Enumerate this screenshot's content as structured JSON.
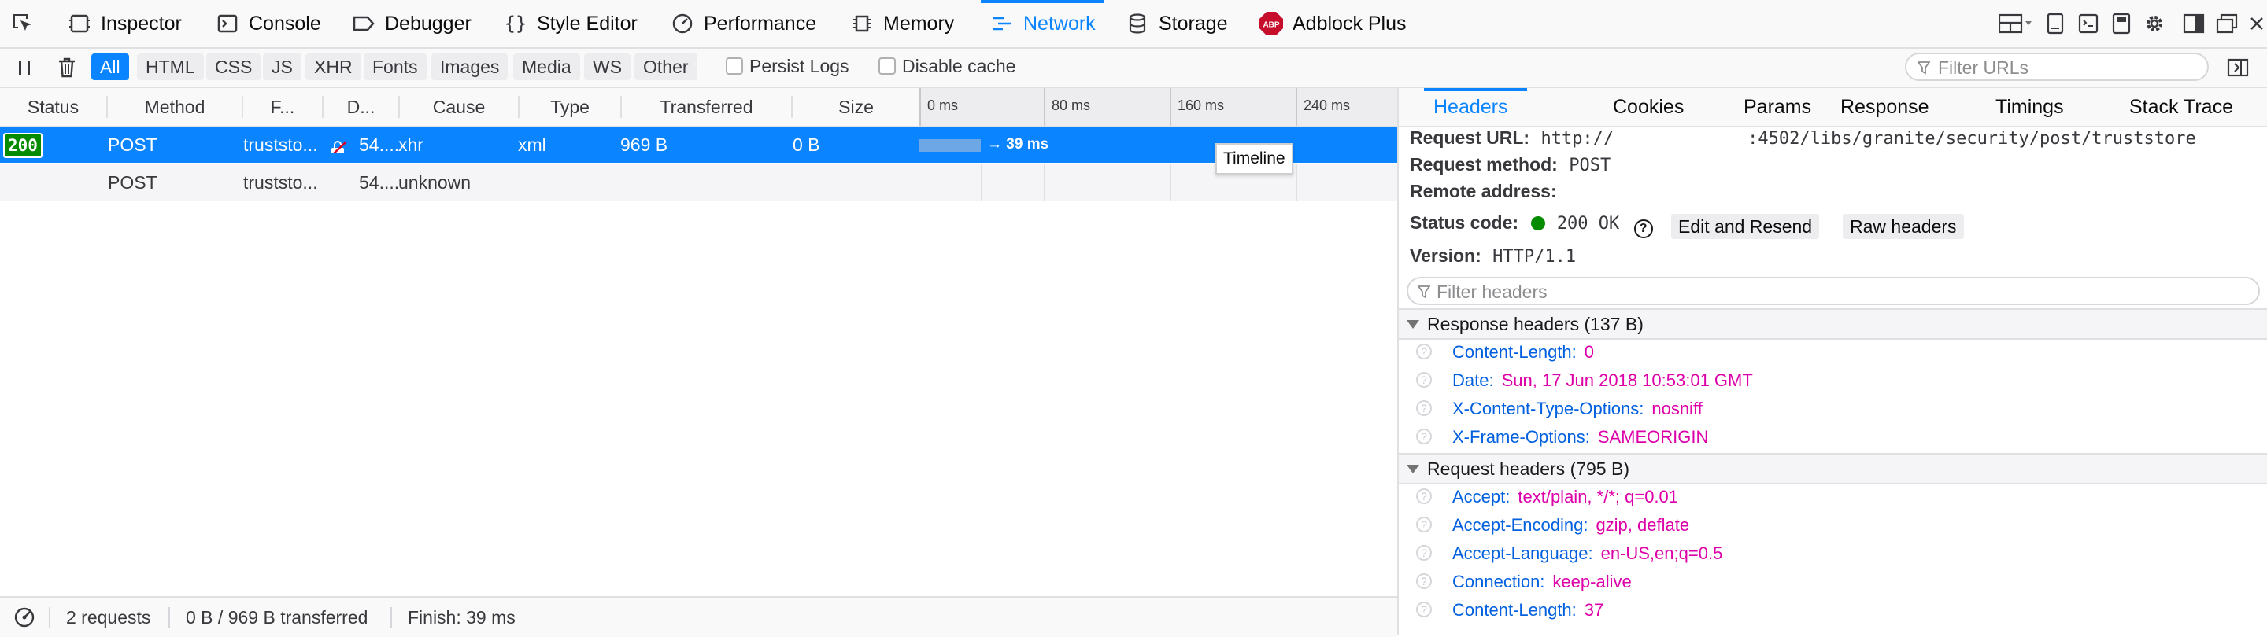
{
  "toolbar": {
    "tabs": [
      {
        "label": "Inspector",
        "icon": "inspector-icon"
      },
      {
        "label": "Console",
        "icon": "console-icon"
      },
      {
        "label": "Debugger",
        "icon": "debugger-icon"
      },
      {
        "label": "Style Editor",
        "icon": "style-editor-icon"
      },
      {
        "label": "Performance",
        "icon": "performance-icon"
      },
      {
        "label": "Memory",
        "icon": "memory-icon"
      },
      {
        "label": "Network",
        "icon": "network-icon",
        "active": true
      },
      {
        "label": "Storage",
        "icon": "storage-icon"
      },
      {
        "label": "Adblock Plus",
        "icon": "adblock-plus-icon"
      }
    ],
    "abp_badge": "ABP",
    "accent_color": "#0a84ff"
  },
  "filterbar": {
    "types": [
      "All",
      "HTML",
      "CSS",
      "JS",
      "XHR",
      "Fonts",
      "Images",
      "Media",
      "WS",
      "Other"
    ],
    "active_type": "All",
    "persist_logs_label": "Persist Logs",
    "disable_cache_label": "Disable cache",
    "filter_urls_placeholder": "Filter URLs"
  },
  "table": {
    "columns": [
      "Status",
      "Method",
      "F...",
      "D...",
      "Cause",
      "Type",
      "Transferred",
      "Size"
    ],
    "waterfall_ticks": [
      "0 ms",
      "80 ms",
      "160 ms",
      "240 ms"
    ],
    "rows": [
      {
        "status": "200",
        "method": "POST",
        "file": "truststo...",
        "domain": "54....",
        "cause": "xhr",
        "type": "xml",
        "transferred": "969 B",
        "size": "0 B",
        "timing": "→ 39 ms",
        "selected": true
      },
      {
        "status": "",
        "method": "POST",
        "file": "truststo...",
        "domain": "54....",
        "cause": "unknown",
        "type": "",
        "transferred": "",
        "size": "",
        "timing": "",
        "selected": false
      }
    ],
    "tooltip": "Timeline"
  },
  "statusbar": {
    "requests": "2 requests",
    "transferred": "0 B / 969 B transferred",
    "finish": "Finish: 39 ms"
  },
  "details": {
    "tabs": [
      "Headers",
      "Cookies",
      "Params",
      "Response",
      "Timings",
      "Stack Trace"
    ],
    "active_tab": "Headers",
    "request_url_label": "Request URL:",
    "request_url_value": "http://",
    "request_url_value_tail": ":4502/libs/granite/security/post/truststore",
    "request_method_label": "Request method:",
    "request_method_value": "POST",
    "remote_address_label": "Remote address:",
    "status_code_label": "Status code:",
    "status_code_value": "200 OK",
    "status_color": "#058b00",
    "edit_resend_label": "Edit and Resend",
    "raw_headers_label": "Raw headers",
    "version_label": "Version:",
    "version_value": "HTTP/1.1",
    "filter_headers_placeholder": "Filter headers",
    "response_headers_title": "Response headers (137 B)",
    "response_headers": [
      {
        "name": "Content-Length:",
        "value": "0"
      },
      {
        "name": "Date:",
        "value": "Sun, 17 Jun 2018 10:53:01 GMT"
      },
      {
        "name": "X-Content-Type-Options:",
        "value": "nosniff"
      },
      {
        "name": "X-Frame-Options:",
        "value": "SAMEORIGIN"
      }
    ],
    "request_headers_title": "Request headers (795 B)",
    "request_headers": [
      {
        "name": "Accept:",
        "value": "text/plain, */*; q=0.01"
      },
      {
        "name": "Accept-Encoding:",
        "value": "gzip, deflate"
      },
      {
        "name": "Accept-Language:",
        "value": "en-US,en;q=0.5"
      },
      {
        "name": "Connection:",
        "value": "keep-alive"
      },
      {
        "name": "Content-Length:",
        "value": "37"
      }
    ]
  }
}
